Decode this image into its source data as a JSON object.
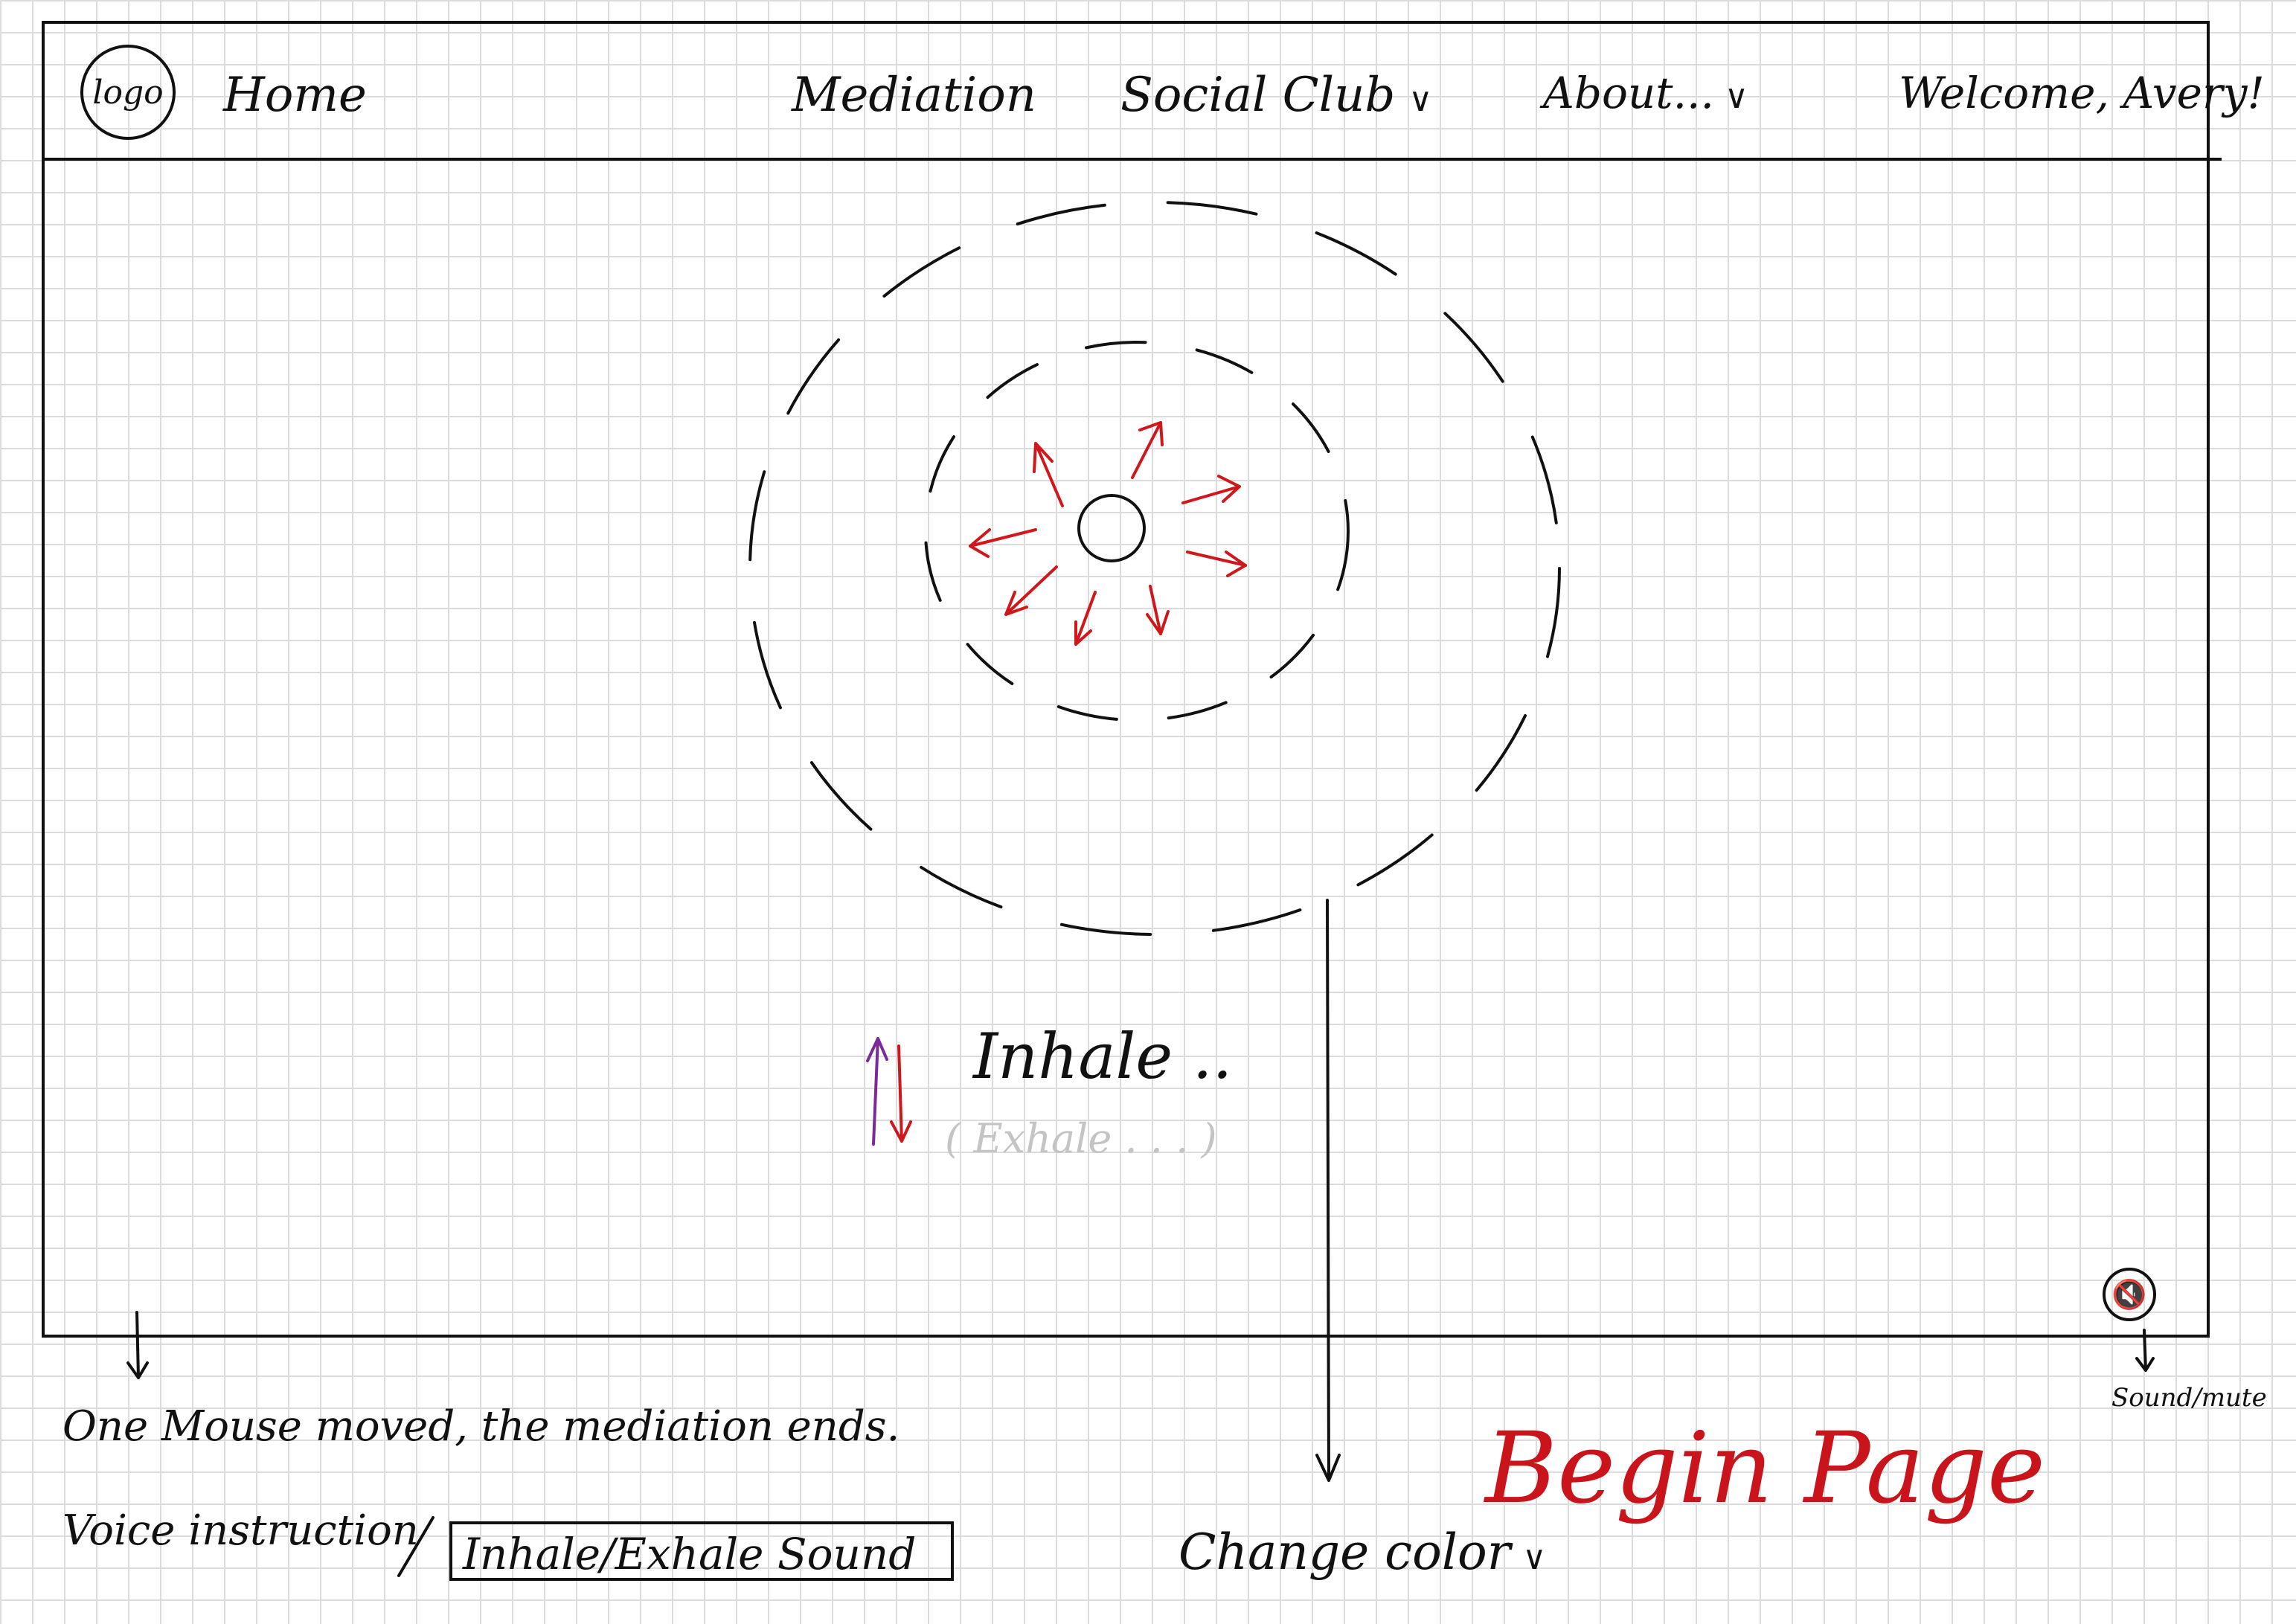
{
  "navbar": {
    "logo_label": "logo",
    "home": "Home",
    "meditation": "Mediation",
    "social_club": "Social Club",
    "about": "About...",
    "welcome": "Welcome, Avery!"
  },
  "breathing": {
    "inhale": "Inhale ..",
    "exhale": "( Exhale . . . )"
  },
  "annotations": {
    "mouse_note": "One Mouse moved, the mediation ends.",
    "voice_label": "Voice instruction",
    "voice_value": "Inhale/Exhale Sound",
    "change_color": "Change color",
    "sound_mute": "Sound/mute",
    "page_title": "Begin Page"
  },
  "icons": {
    "sound": "speaker-mute-icon",
    "dropdown": "chevron-down-icon"
  },
  "colors": {
    "ink": "#111111",
    "arrows": "#d0181c",
    "inhale_arrow": "#7a2a9a",
    "exhale_text": "#c4c4c4",
    "page_title": "#c8141a"
  }
}
